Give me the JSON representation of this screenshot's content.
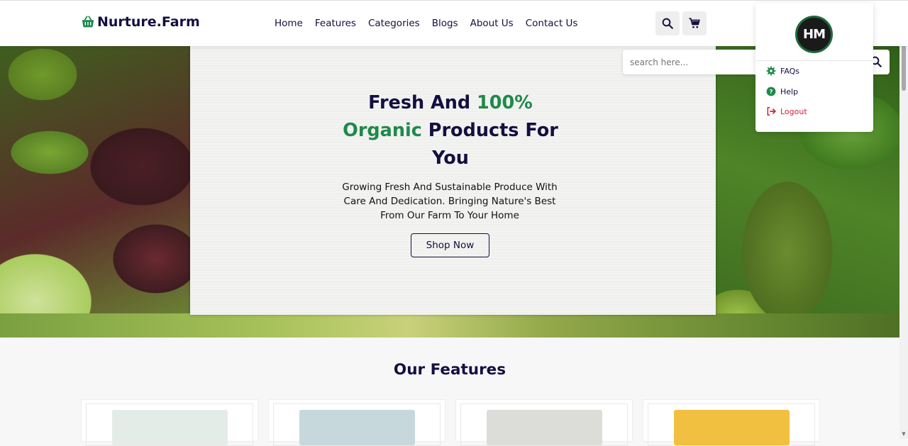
{
  "brand": {
    "name": "Nurture.Farm",
    "logo_icon": "basket-icon",
    "accent": "#1e8a4a",
    "navy": "#130f40"
  },
  "nav": {
    "items": [
      "Home",
      "Features",
      "Categories",
      "Blogs",
      "About Us",
      "Contact Us"
    ]
  },
  "header_icons": {
    "search": "search-icon",
    "cart": "cart-icon"
  },
  "search": {
    "placeholder": "search here..."
  },
  "hero": {
    "title_part1": "Fresh And ",
    "title_highlight1": "100%",
    "title_highlight2": "Organic",
    "title_part2": " Products For You",
    "subtitle": "Growing Fresh And Sustainable Produce With Care And Dedication. Bringing Nature's Best From Our Farm To Your Home",
    "cta": "Shop Now"
  },
  "user_menu": {
    "avatar_initials": "HM",
    "items": [
      {
        "label": "FAQs",
        "icon": "gear-icon"
      },
      {
        "label": "Help",
        "icon": "question-circle-icon"
      },
      {
        "label": "Logout",
        "icon": "logout-icon"
      }
    ]
  },
  "features": {
    "title": "Our Features"
  }
}
